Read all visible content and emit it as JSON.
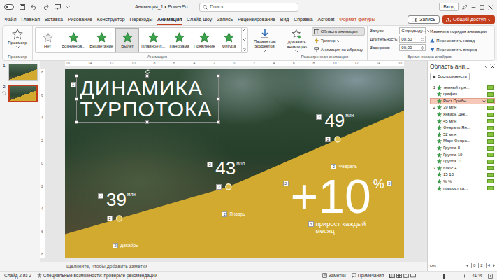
{
  "window": {
    "title": "Анимация_1 • PowerPo...",
    "search_placeholder": "Поиск",
    "sign_in": "Вход"
  },
  "ribbon_tabs": [
    {
      "label": "Файл",
      "selected": false,
      "kind": "standard"
    },
    {
      "label": "Главная",
      "selected": false,
      "kind": "standard"
    },
    {
      "label": "Вставка",
      "selected": false,
      "kind": "standard"
    },
    {
      "label": "Рисование",
      "selected": false,
      "kind": "standard"
    },
    {
      "label": "Конструктор",
      "selected": false,
      "kind": "standard"
    },
    {
      "label": "Переходы",
      "selected": false,
      "kind": "standard"
    },
    {
      "label": "Анимация",
      "selected": true,
      "kind": "standard"
    },
    {
      "label": "Слайд-шоу",
      "selected": false,
      "kind": "standard"
    },
    {
      "label": "Запись",
      "selected": false,
      "kind": "standard"
    },
    {
      "label": "Рецензирование",
      "selected": false,
      "kind": "standard"
    },
    {
      "label": "Вид",
      "selected": false,
      "kind": "standard"
    },
    {
      "label": "Справка",
      "selected": false,
      "kind": "standard"
    },
    {
      "label": "Acrobat",
      "selected": false,
      "kind": "standard"
    },
    {
      "label": "Формат фигуры",
      "selected": false,
      "kind": "contextual"
    }
  ],
  "record_button": "Запись",
  "share_button": "Общий доступ",
  "ribbon": {
    "preview": {
      "button": "Просмотр",
      "group": "Просмотр"
    },
    "animation": {
      "group": "Анимация",
      "effects": [
        {
          "label": "Нет",
          "selected": false,
          "kind": "none"
        },
        {
          "label": "Возникнов...",
          "selected": false,
          "kind": "entrance"
        },
        {
          "label": "Выцветание",
          "selected": false,
          "kind": "entrance"
        },
        {
          "label": "Вылет",
          "selected": true,
          "kind": "entrance"
        },
        {
          "label": "Плавное п...",
          "selected": false,
          "kind": "entrance"
        },
        {
          "label": "Панорама",
          "selected": false,
          "kind": "entrance"
        },
        {
          "label": "Появление",
          "selected": false,
          "kind": "entrance"
        },
        {
          "label": "Фигура",
          "selected": false,
          "kind": "entrance"
        }
      ],
      "effect_options": "Параметры эффектов"
    },
    "advanced": {
      "group": "Расширенная анимация",
      "add_animation": "Добавить анимацию",
      "items": [
        {
          "label": "Область анимации",
          "selected": true
        },
        {
          "label": "Триггер",
          "selected": false
        },
        {
          "label": "Анимация по образцу",
          "selected": false
        }
      ]
    },
    "timing": {
      "group": "Время показа слайдов",
      "fields": [
        {
          "label": "Запуск:",
          "value": "С предыду...",
          "kind": "dropdown"
        },
        {
          "label": "Длительность:",
          "value": "00,50",
          "kind": "spinner"
        },
        {
          "label": "Задержка:",
          "value": "00,00",
          "kind": "spinner"
        }
      ],
      "reorder_title": "Изменить порядок анимации",
      "reorder": [
        "Переместить назад",
        "Переместить вперед"
      ]
    }
  },
  "thumbnails": [
    {
      "number": "1",
      "selected": false,
      "animated": false
    },
    {
      "number": "2",
      "selected": true,
      "animated": true
    }
  ],
  "rulers": {
    "top": [
      "16",
      "14",
      "12",
      "10",
      "8",
      "6",
      "4",
      "2",
      "0",
      "2",
      "4",
      "6",
      "8",
      "10",
      "12",
      "14",
      "16"
    ],
    "left": [
      "8",
      "6",
      "4",
      "2",
      "0",
      "2",
      "4",
      "6",
      "8"
    ]
  },
  "slide": {
    "title": {
      "lines": [
        "ДИНАМИКА",
        "ТУРПОТОКА"
      ],
      "badge": "1",
      "selected": true
    },
    "chart": {
      "values": [
        39,
        43,
        49
      ]
    },
    "points": [
      {
        "value": "39",
        "unit": "млн",
        "month": "Декабрь",
        "badges": [
          "2",
          "2",
          "2"
        ]
      },
      {
        "value": "43",
        "unit": "млн",
        "month": "Январь",
        "badges": [
          "2",
          "2",
          "2"
        ]
      },
      {
        "value": "49",
        "unit": "млн",
        "month": "Февраль",
        "badges": [
          "2",
          "2",
          "2"
        ]
      }
    ],
    "growth": {
      "value": "+10",
      "unit": "%",
      "caption": [
        "прирост каждый",
        "месяц"
      ],
      "badges": [
        "3",
        "3",
        "3"
      ]
    }
  },
  "notes_placeholder": "Щелкните, чтобы добавить заметки",
  "animation_pane": {
    "title": "Область ани...",
    "play": "Воспроизвести",
    "items": [
      {
        "number": "1",
        "label": "темный пря...",
        "selected": false
      },
      {
        "label": "график",
        "selected": false
      },
      {
        "label": "Рост Прибы...",
        "selected": true
      },
      {
        "number": "2",
        "label": "39 млн",
        "selected": false
      },
      {
        "label": "январь Дек...",
        "selected": false
      },
      {
        "label": "45 млн",
        "selected": false
      },
      {
        "label": "Февраль Ян...",
        "selected": false
      },
      {
        "label": "52 млн",
        "selected": false
      },
      {
        "label": "Март Февра...",
        "selected": false
      },
      {
        "label": "Группа 8",
        "selected": false
      },
      {
        "label": "Группа 10",
        "selected": false
      },
      {
        "label": "Группа 11",
        "selected": false
      },
      {
        "number": "3",
        "label": "плюс +",
        "selected": false
      },
      {
        "label": "15 10",
        "selected": false
      },
      {
        "label": "% %",
        "selected": false
      },
      {
        "label": "прирост ка...",
        "selected": false
      }
    ],
    "timeline": {
      "unit": "сек",
      "ticks": [
        "0",
        "2",
        "4"
      ]
    }
  },
  "status_bar": {
    "slide": "Слайд 2 из 2",
    "accessibility": "Специальные возможности: проверьте рекомендации",
    "notes": "Заметки",
    "comments": "Примечания",
    "zoom": {
      "text": "41 %",
      "level": 0.5
    }
  }
}
